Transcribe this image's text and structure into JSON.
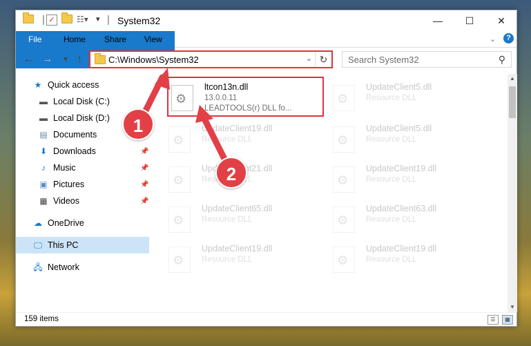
{
  "window": {
    "title": "System32",
    "controls": {
      "minimize": "—",
      "maximize": "☐",
      "close": "✕"
    }
  },
  "ribbon": {
    "tabs": [
      {
        "label": "File"
      },
      {
        "label": "Home"
      },
      {
        "label": "Share"
      },
      {
        "label": "View"
      }
    ],
    "expand_icon": "chevron-down-icon",
    "help_icon": "?"
  },
  "navigation": {
    "back": "←",
    "forward": "→",
    "recent": "▾",
    "up": "↑",
    "address": "C:\\Windows\\System32",
    "refresh": "↻",
    "search_placeholder": "Search System32"
  },
  "sidebar": {
    "items": [
      {
        "label": "Quick access",
        "icon": "star-icon",
        "pinned": false
      },
      {
        "label": "Local Disk (C:)",
        "icon": "drive-icon",
        "pinned": false
      },
      {
        "label": "Local Disk (D:)",
        "icon": "drive-icon",
        "pinned": false
      },
      {
        "label": "Documents",
        "icon": "documents-icon",
        "pinned": true
      },
      {
        "label": "Downloads",
        "icon": "download-icon",
        "pinned": true
      },
      {
        "label": "Music",
        "icon": "music-icon",
        "pinned": true
      },
      {
        "label": "Pictures",
        "icon": "pictures-icon",
        "pinned": true
      },
      {
        "label": "Videos",
        "icon": "video-icon",
        "pinned": true
      },
      {
        "label": "OneDrive",
        "icon": "cloud-icon",
        "pinned": false
      },
      {
        "label": "This PC",
        "icon": "computer-icon",
        "pinned": false,
        "selected": true
      },
      {
        "label": "Network",
        "icon": "network-icon",
        "pinned": false
      }
    ]
  },
  "files": [
    {
      "name": "ltcon13n.dll",
      "line1": "13.0.0.11",
      "line2": "LEADTOOLS(r) DLL fo...",
      "highlighted": true
    },
    {
      "name": "UpdateClient5.dll",
      "line1": "Resource DLL",
      "line2": ""
    },
    {
      "name": "UpdateClient19.dll",
      "line1": "Resource DLL",
      "line2": ""
    },
    {
      "name": "UpdateClient5.dll",
      "line1": "Resource DLL",
      "line2": ""
    },
    {
      "name": "UpdateClient21.dll",
      "line1": "Resource DLL",
      "line2": ""
    },
    {
      "name": "UpdateClient19.dll",
      "line1": "Resource DLL",
      "line2": ""
    },
    {
      "name": "UpdateClient65.dll",
      "line1": "Resource DLL",
      "line2": ""
    },
    {
      "name": "UpdateClient63.dll",
      "line1": "Resource DLL",
      "line2": ""
    },
    {
      "name": "UpdateClient19.dll",
      "line1": "Resource DLL",
      "line2": ""
    },
    {
      "name": "UpdateClient19.dll",
      "line1": "Resource DLL",
      "line2": ""
    }
  ],
  "status": {
    "item_count": "159 items"
  },
  "annotations": {
    "marker1": "1",
    "marker2": "2"
  },
  "colors": {
    "accent": "#1979ca",
    "highlight_red": "#e0323c",
    "selected_bg": "#cce4f7"
  }
}
